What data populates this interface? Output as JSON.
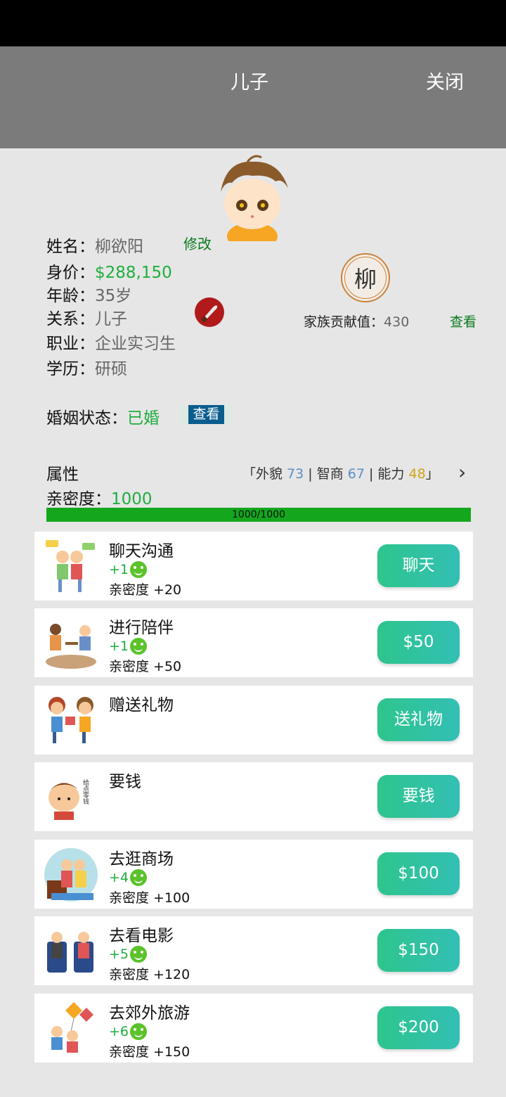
{
  "header": {
    "title": "儿子",
    "close_label": "关闭"
  },
  "profile": {
    "name_label": "姓名：",
    "name_value": "柳欲阳",
    "edit_label": "修改",
    "worth_label": "身价：",
    "worth_value": "$288,150",
    "age_label": "年龄：",
    "age_value": "35岁",
    "relation_label": "关系：",
    "relation_value": "儿子",
    "job_label": "职业：",
    "job_value": "企业实习生",
    "edu_label": "学历：",
    "edu_value": "研硕"
  },
  "family": {
    "seal_char": "柳",
    "contribution_label": "家族贡献值：",
    "contribution_value": "430",
    "view_label": "查看"
  },
  "marriage": {
    "label": "婚姻状态：",
    "value": "已婚",
    "view_label": "查看"
  },
  "attributes": {
    "label": "属性",
    "open": "「外貌 ",
    "looks": "73",
    "sep1": " | 智商 ",
    "iq": "67",
    "sep2": " | 能力 ",
    "ability": "48",
    "close": "」"
  },
  "intimacy": {
    "label": "亲密度：",
    "value": "1000",
    "progress_text": "1000/1000",
    "progress": 1.0
  },
  "actions": [
    {
      "title": "聊天沟通",
      "gain": "+1",
      "intimacy": "亲密度 +20",
      "button": "聊天",
      "icon": "chat-illustration-icon"
    },
    {
      "title": "进行陪伴",
      "gain": "+1",
      "intimacy": "亲密度 +50",
      "button": "$50",
      "icon": "companionship-illustration-icon"
    },
    {
      "title": "赠送礼物",
      "gain": "",
      "intimacy": "",
      "button": "送礼物",
      "icon": "gift-illustration-icon"
    },
    {
      "title": "要钱",
      "gain": "",
      "intimacy": "",
      "button": "要钱",
      "icon": "ask-money-illustration-icon",
      "badge_text": "给点零钱"
    },
    {
      "title": "去逛商场",
      "gain": "+4",
      "intimacy": "亲密度 +100",
      "button": "$100",
      "icon": "mall-illustration-icon"
    },
    {
      "title": "去看电影",
      "gain": "+5",
      "intimacy": "亲密度 +120",
      "button": "$150",
      "icon": "movie-illustration-icon"
    },
    {
      "title": "去郊外旅游",
      "gain": "+6",
      "intimacy": "亲密度 +150",
      "button": "$200",
      "icon": "kite-illustration-icon"
    }
  ]
}
